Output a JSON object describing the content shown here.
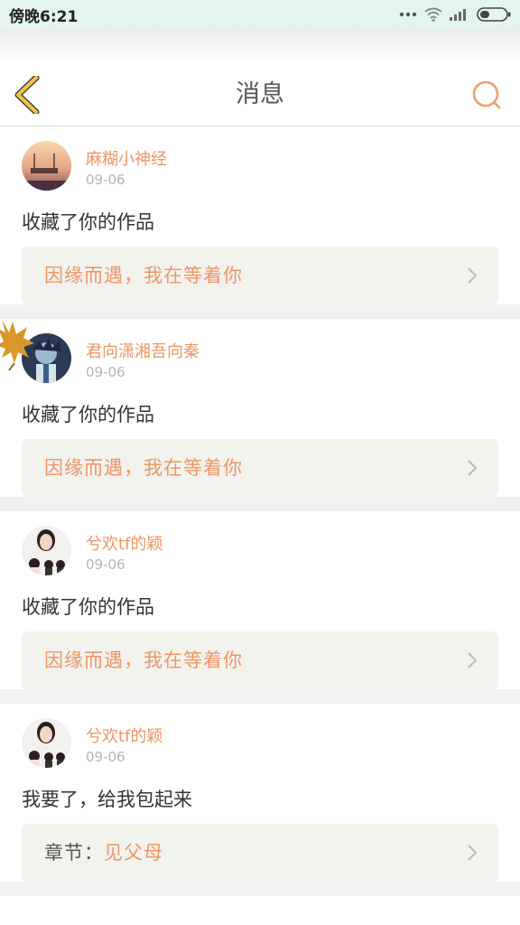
{
  "status_bar": {
    "time": "傍晚6:21",
    "icons": [
      "dots-icon",
      "wifi-icon",
      "signal-icon",
      "battery-icon"
    ]
  },
  "header": {
    "title": "消息",
    "back_icon": "chevron-left-icon",
    "search_icon": "search-icon"
  },
  "colors": {
    "accent": "#ef9566",
    "back_icon": "#f1c24c",
    "status_bar_bg": "#e3f4f1",
    "card_bg": "#f3f3ee"
  },
  "messages": [
    {
      "user": "麻糊小神经",
      "date": "09-06",
      "text": "收藏了你的作品",
      "work_title": "因缘而遇，我在等着你"
    },
    {
      "user": "君向潇湘吾向秦",
      "date": "09-06",
      "text": "收藏了你的作品",
      "work_title": "因缘而遇，我在等着你"
    },
    {
      "user": "兮欢tf的颖",
      "date": "09-06",
      "text": "收藏了你的作品",
      "work_title": "因缘而遇，我在等着你"
    },
    {
      "user": "兮欢tf的颖",
      "date": "09-06",
      "text": "我要了，给我包起来",
      "chapter_prefix": "章节：",
      "chapter_title": "见父母"
    }
  ]
}
